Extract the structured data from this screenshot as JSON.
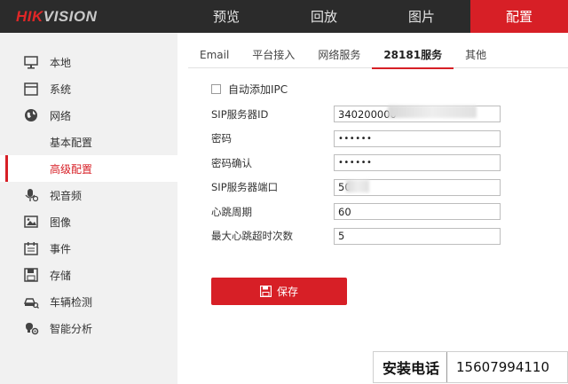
{
  "brand": {
    "hik": "HIK",
    "vision": "VISION"
  },
  "topnav": [
    {
      "label": "预览",
      "active": false
    },
    {
      "label": "回放",
      "active": false
    },
    {
      "label": "图片",
      "active": false
    },
    {
      "label": "配置",
      "active": true
    }
  ],
  "sidebar": {
    "items": [
      {
        "label": "本地",
        "icon": "monitor-icon"
      },
      {
        "label": "系统",
        "icon": "system-window-icon"
      },
      {
        "label": "网络",
        "icon": "globe-icon"
      },
      {
        "label": "基本配置",
        "sub": true
      },
      {
        "label": "高级配置",
        "sub": true,
        "active": true
      },
      {
        "label": "视音频",
        "icon": "microphone-icon"
      },
      {
        "label": "图像",
        "icon": "image-icon"
      },
      {
        "label": "事件",
        "icon": "calendar-icon"
      },
      {
        "label": "存储",
        "icon": "floppy-disk-icon"
      },
      {
        "label": "车辆检测",
        "icon": "car-search-icon"
      },
      {
        "label": "智能分析",
        "icon": "smart-analysis-icon"
      }
    ]
  },
  "tabs": [
    {
      "label": "Email"
    },
    {
      "label": "平台接入"
    },
    {
      "label": "网络服务"
    },
    {
      "label": "28181服务",
      "active": true
    },
    {
      "label": "其他"
    }
  ],
  "form": {
    "auto_add_ipc_label": "自动添加IPC",
    "sip_id_label": "SIP服务器ID",
    "sip_id_value": "340200000",
    "password_label": "密码",
    "password_value": "••••••",
    "confirm_label": "密码确认",
    "confirm_value": "••••••",
    "sip_port_label": "SIP服务器端口",
    "sip_port_value": "50",
    "heartbeat_label": "心跳周期",
    "heartbeat_value": "60",
    "max_timeout_label": "最大心跳超时次数",
    "max_timeout_value": "5"
  },
  "save_label": "保存",
  "overlay": {
    "label": "安装电话",
    "phone": "15607994110"
  },
  "colors": {
    "accent": "#d71f26",
    "topbar": "#2b2b2b",
    "sidebar": "#f1f1f1"
  }
}
